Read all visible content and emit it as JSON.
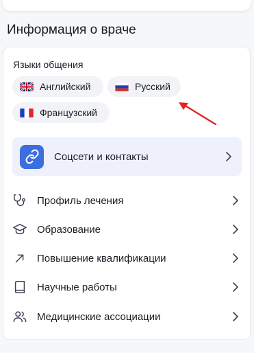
{
  "section": {
    "title": "Информация о враче"
  },
  "languages": {
    "label": "Языки общения",
    "items": [
      {
        "name": "Английский",
        "flag": "uk-flag-icon"
      },
      {
        "name": "Русский",
        "flag": "russia-flag-icon"
      },
      {
        "name": "Французский",
        "flag": "france-flag-icon"
      }
    ]
  },
  "contacts": {
    "label": "Соцсети и контакты",
    "icon": "link-icon"
  },
  "menu": [
    {
      "label": "Профиль лечения",
      "icon": "stethoscope-icon"
    },
    {
      "label": "Образование",
      "icon": "graduation-cap-icon"
    },
    {
      "label": "Повышение квалификации",
      "icon": "arrow-up-right-icon"
    },
    {
      "label": "Научные работы",
      "icon": "book-icon"
    },
    {
      "label": "Медицинские ассоциации",
      "icon": "users-icon"
    }
  ],
  "colors": {
    "accent": "#3d6ee0",
    "contacts_bg": "#eef1fb",
    "chip_bg": "#f1f3f6",
    "annotation": "#e52420"
  }
}
